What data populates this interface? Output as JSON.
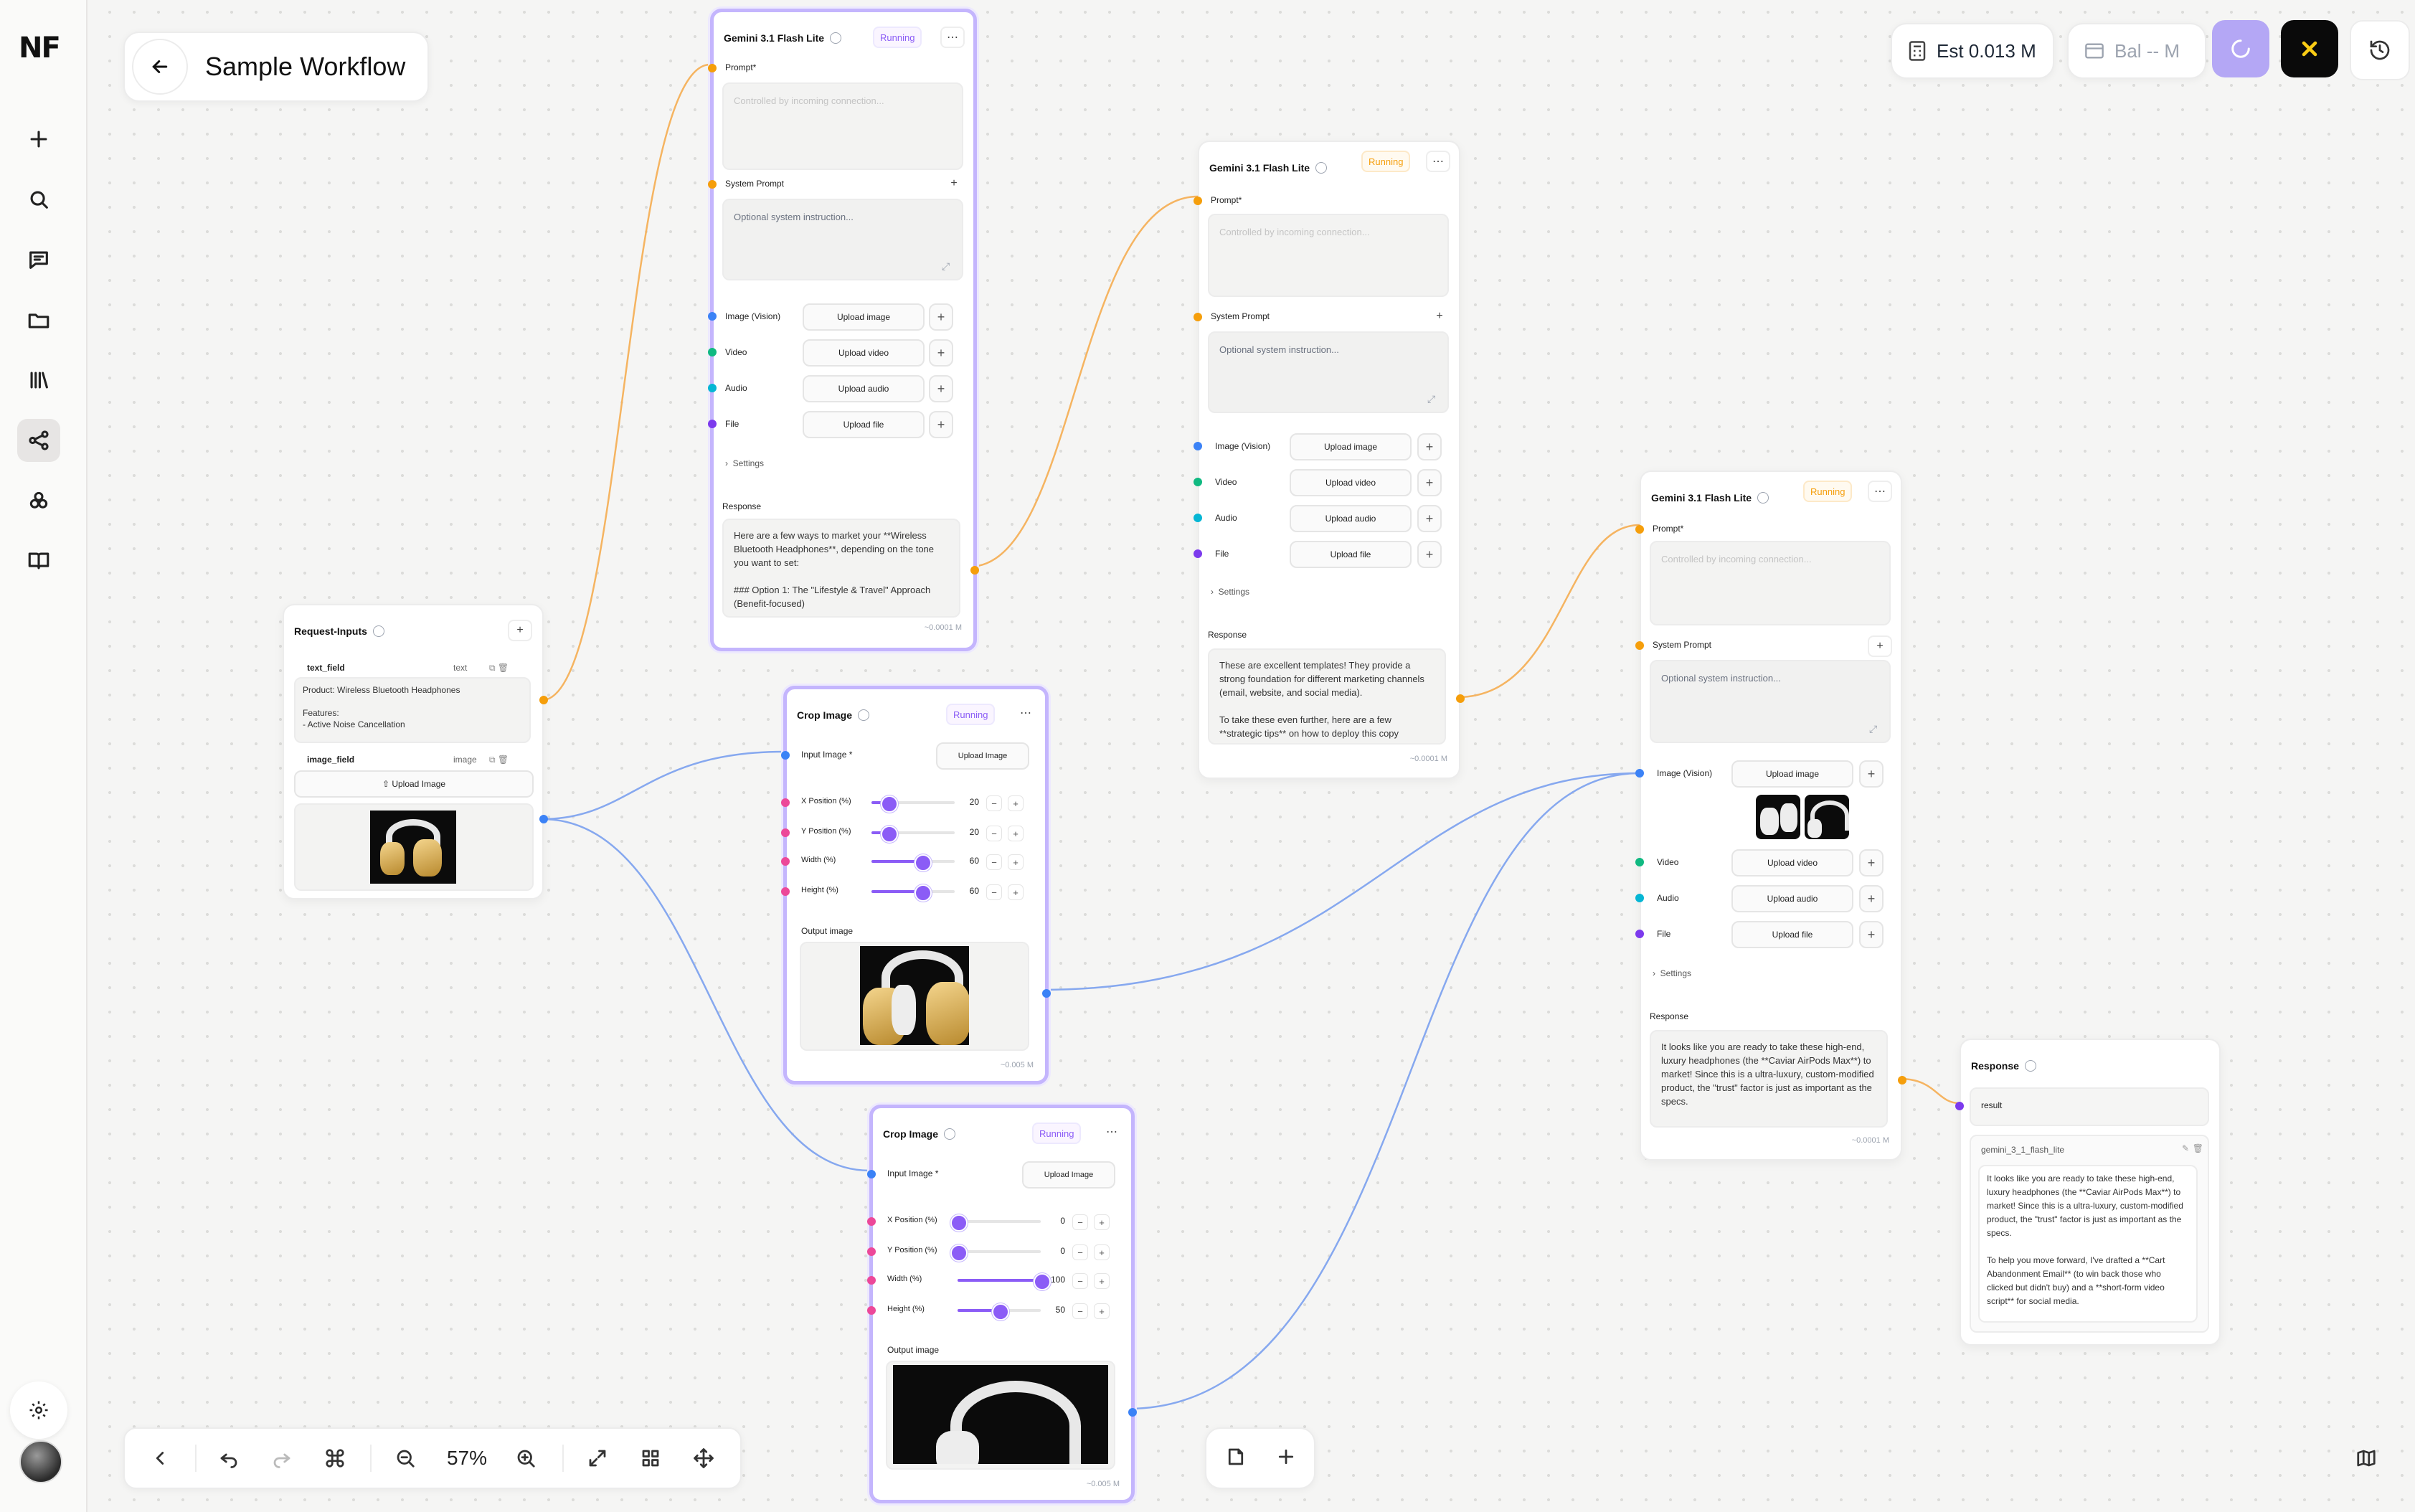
{
  "app": {
    "logo": "NF",
    "workflow_title": "Sample Workflow"
  },
  "topbar": {
    "estimate": "Est 0.013 M",
    "balance": "Bal -- M"
  },
  "toolbar": {
    "zoom": "57%"
  },
  "colors": {
    "accent": "#8b5cf6",
    "prompt_port": "#f59e0b",
    "image_port": "#3b82f6",
    "video_port": "#10b981",
    "audio_port": "#06b6d4",
    "file_port": "#7c3aed",
    "crop_port": "#ec4899"
  },
  "request_inputs": {
    "title": "Request-Inputs",
    "text_field": {
      "name": "text_field",
      "type": "text",
      "value": "Product: Wireless Bluetooth Headphones\n\nFeatures:\n- Active Noise Cancellation"
    },
    "image_field": {
      "name": "image_field",
      "type": "image",
      "upload_label": "Upload Image"
    }
  },
  "gemini_nodes": [
    {
      "title": "Gemini 3.1 Flash Lite",
      "status": "Running",
      "prompt_label": "Prompt*",
      "prompt_placeholder": "Controlled by incoming connection...",
      "system_label": "System Prompt",
      "system_placeholder": "Optional system instruction...",
      "image_label": "Image (Vision)",
      "image_btn": "Upload image",
      "video_label": "Video",
      "video_btn": "Upload video",
      "audio_label": "Audio",
      "audio_btn": "Upload audio",
      "file_label": "File",
      "file_btn": "Upload file",
      "settings_label": "Settings",
      "response_label": "Response",
      "response": "Here are a few ways to market your **Wireless Bluetooth Headphones**, depending on the tone you want to set:\n\n### Option 1: The \"Lifestyle & Travel\" Approach (Benefit-focused)",
      "cost": "~0.0001 M"
    },
    {
      "title": "Gemini 3.1 Flash Lite",
      "status": "Running",
      "prompt_label": "Prompt*",
      "prompt_placeholder": "Controlled by incoming connection...",
      "system_label": "System Prompt",
      "system_placeholder": "Optional system instruction...",
      "image_label": "Image (Vision)",
      "image_btn": "Upload image",
      "video_label": "Video",
      "video_btn": "Upload video",
      "audio_label": "Audio",
      "audio_btn": "Upload audio",
      "file_label": "File",
      "file_btn": "Upload file",
      "settings_label": "Settings",
      "response_label": "Response",
      "response": "These are excellent templates! They provide a strong foundation for different marketing channels (email, website, and social media).\n\nTo take these even further, here are a few **strategic tips** on how to deploy this copy",
      "cost": "~0.0001 M"
    },
    {
      "title": "Gemini 3.1 Flash Lite",
      "status": "Running",
      "prompt_label": "Prompt*",
      "prompt_placeholder": "Controlled by incoming connection...",
      "system_label": "System Prompt",
      "system_placeholder": "Optional system instruction...",
      "image_label": "Image (Vision)",
      "image_btn": "Upload image",
      "video_label": "Video",
      "video_btn": "Upload video",
      "audio_label": "Audio",
      "audio_btn": "Upload audio",
      "file_label": "File",
      "file_btn": "Upload file",
      "settings_label": "Settings",
      "response_label": "Response",
      "response": "It looks like you are ready to take these high-end, luxury headphones (the **Caviar AirPods Max**) to market! Since this is a ultra-luxury, custom-modified product, the \"trust\" factor is just as important as the specs.",
      "cost": "~0.0001 M"
    }
  ],
  "crop_nodes": [
    {
      "title": "Crop Image",
      "status": "Running",
      "input_label": "Input Image *",
      "upload_btn": "Upload Image",
      "x_label": "X Position (%)",
      "x": "20",
      "x_value": 20,
      "y_label": "Y Position (%)",
      "y": "20",
      "y_value": 20,
      "w_label": "Width (%)",
      "w": "60",
      "w_value": 60,
      "h_label": "Height (%)",
      "h": "60",
      "h_value": 60,
      "output_label": "Output image",
      "cost": "~0.005 M"
    },
    {
      "title": "Crop Image",
      "status": "Running",
      "input_label": "Input Image *",
      "upload_btn": "Upload Image",
      "x_label": "X Position (%)",
      "x": "0",
      "x_value": 0,
      "y_label": "Y Position (%)",
      "y": "0",
      "y_value": 0,
      "w_label": "Width (%)",
      "w": "100",
      "w_value": 100,
      "h_label": "Height (%)",
      "h": "50",
      "h_value": 50,
      "output_label": "Output image",
      "cost": "~0.005 M"
    }
  ],
  "response_node": {
    "title": "Response",
    "field": "result",
    "source": "gemini_3_1_flash_lite",
    "text": "It looks like you are ready to take these high-end, luxury headphones (the **Caviar AirPods Max**) to market! Since this is a ultra-luxury, custom-modified product, the \"trust\" factor is just as important as the specs.\n\nTo help you move forward, I've drafted a **Cart Abandonment Email** (to win back those who clicked but didn't buy) and a **short-form video script** for social media."
  }
}
